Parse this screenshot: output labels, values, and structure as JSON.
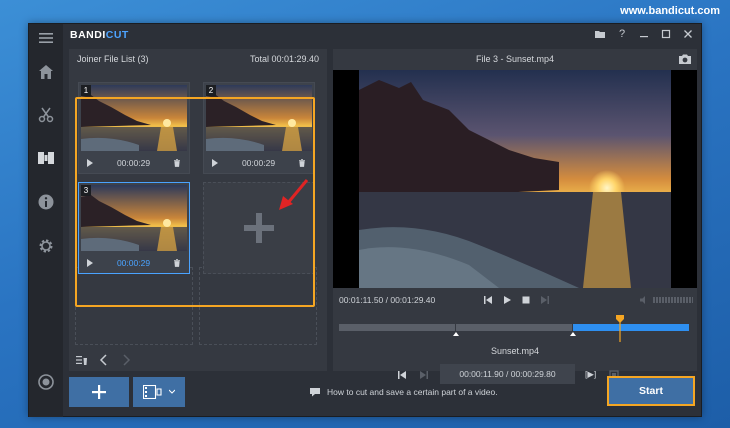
{
  "site_url": "www.bandicut.com",
  "app": {
    "logo_part1": "BANDI",
    "logo_part2": "CUT"
  },
  "left_panel": {
    "title": "Joiner File List (3)",
    "total": "Total 00:01:29.40",
    "files": [
      {
        "index": "1",
        "duration": "00:00:29"
      },
      {
        "index": "2",
        "duration": "00:00:29"
      },
      {
        "index": "3",
        "duration": "00:00:29"
      }
    ]
  },
  "right_panel": {
    "title": "File 3 - Sunset.mp4",
    "time_display": "00:01:11.50 / 00:01:29.40",
    "filename": "Sunset.mp4",
    "range_display": "00:00:11.90 / 00:00:29.80"
  },
  "bottom": {
    "hint": "How to cut and save a certain part of a video.",
    "start_label": "Start"
  },
  "colors": {
    "accent": "#4aa3ff",
    "highlight": "#f5a623",
    "button": "#3f6fa4"
  }
}
